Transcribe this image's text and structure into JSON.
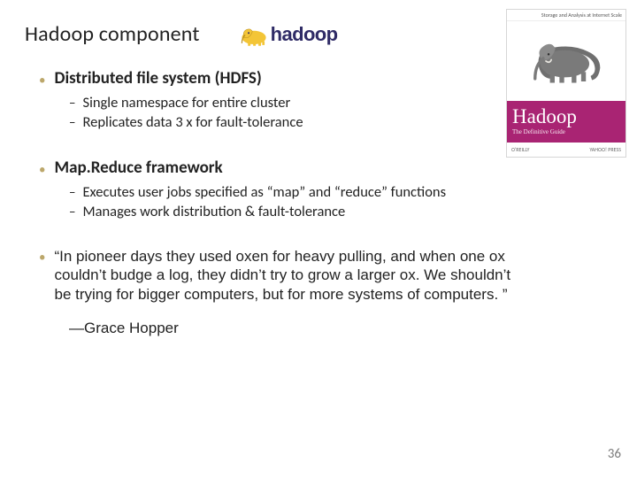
{
  "title": "Hadoop component",
  "logo": {
    "wordmark": "hadoop"
  },
  "book": {
    "header": "Storage and Analysis at Internet Scale",
    "title": "Hadoop",
    "subtitle": "The Definitive Guide",
    "publisher_left": "O'REILLY",
    "publisher_right": "YAHOO! PRESS"
  },
  "sections": [
    {
      "heading": "Distributed file system (HDFS)",
      "items": [
        "Single namespace for entire cluster",
        "Replicates data 3 x for fault-tolerance"
      ]
    },
    {
      "heading": "Map.Reduce framework",
      "items": [
        "Executes user jobs specified as “map” and “reduce” functions",
        "Manages work distribution & fault-tolerance"
      ]
    }
  ],
  "quote": {
    "text": "“In pioneer days they used oxen for heavy pulling, and when one ox couldn’t budge a log, they didn’t try to grow a larger ox. We shouldn’t be trying for bigger computers, but for more systems of computers. ”",
    "attribution": "—Grace Hopper"
  },
  "page_number": "36"
}
